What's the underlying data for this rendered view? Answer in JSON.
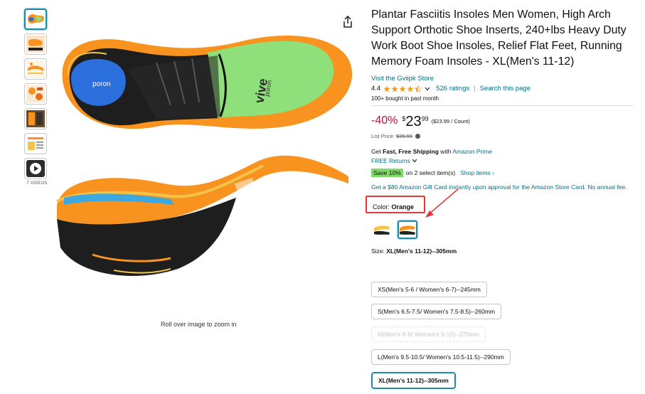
{
  "thumbnails": [
    {
      "name": "thumb-insole-bottom",
      "active": true
    },
    {
      "name": "thumb-insole-features",
      "active": false
    },
    {
      "name": "thumb-insole-layers",
      "active": false
    },
    {
      "name": "thumb-insole-infographic",
      "active": false
    },
    {
      "name": "thumb-insole-usage",
      "active": false
    },
    {
      "name": "thumb-insole-sizes",
      "active": false
    },
    {
      "name": "thumb-video",
      "active": false
    }
  ],
  "videos_label": "7 VIDEOS",
  "zoom_hint": "Roll over image to zoom in",
  "product": {
    "title": "Plantar Fasciitis Insoles Men Women, High Arch Support Orthotic Shoe Inserts, 240+lbs Heavy Duty Work Boot Shoe Insoles, Relief Flat Feet, Running Memory Foam Insoles - XL(Men's 11-12)",
    "store_link": "Visit the Gviipk Store",
    "rating": "4.4",
    "stars_value": 4.4,
    "ratings_count": "526 ratings",
    "search_page": "Search this page",
    "bought": "100+ bought in past month"
  },
  "price": {
    "discount": "-40%",
    "symbol": "$",
    "whole": "23",
    "fraction": "99",
    "unit": "($23.99 / Count)",
    "list_label": "List Price:",
    "list_value": "$39.99"
  },
  "shipping": {
    "prefix": "Get ",
    "bold": "Fast, Free Shipping",
    "with": " with ",
    "prime": "Amazon Prime",
    "returns": "FREE Returns"
  },
  "promo": {
    "badge": "Save 10%",
    "text": "on 2 select item(s)",
    "shop": "Shop items ›",
    "giftcard": "Get a $80 Amazon Gift Card instantly upon approval for the Amazon Store Card. No annual fee."
  },
  "color": {
    "label": "Color: ",
    "value": "Orange"
  },
  "size": {
    "label": "Size: ",
    "value": "XL(Men's 11-12)--305mm",
    "options": [
      {
        "label": "XS(Men's 5-6 / Women's 6-7)--245mm",
        "state": "normal"
      },
      {
        "label": "S(Men's 6.5-7.5/ Women's 7.5-8.5)--260mm",
        "state": "normal"
      },
      {
        "label": "M(Men's 8-9/ Women's 9-10)--275mm",
        "state": "disabled"
      },
      {
        "label": "L(Men's 9.5-10.5/ Women's 10.5-11.5)--290mm",
        "state": "normal"
      },
      {
        "label": "XL(Men's 11-12)--305mm",
        "state": "selected"
      }
    ]
  },
  "colors": {
    "link": "#007185",
    "discount": "#cc0c39",
    "star": "#f69f1e",
    "save_badge": "#7fda69",
    "insole_orange": "#f7931e",
    "insole_green": "#8fe07a",
    "highlight": "#e03a3a"
  },
  "image_text": {
    "heel_logo": "poron",
    "arch_logo": "poron",
    "brand": "vive"
  }
}
